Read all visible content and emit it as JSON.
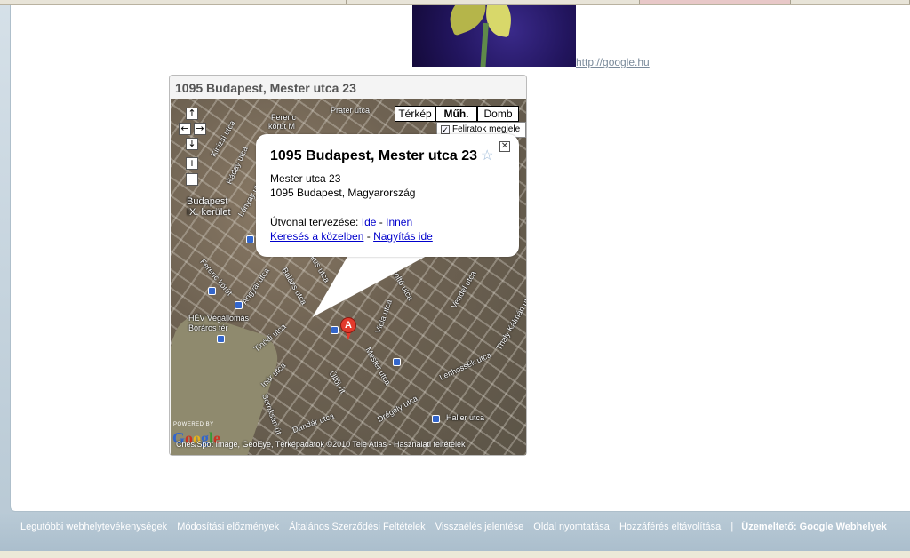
{
  "image_link": "http://google.hu",
  "map": {
    "title": "1095 Budapest, Mester utca 23",
    "map_types": [
      "Térkép",
      "Műh.",
      "Domb"
    ],
    "active_map_type": "Műh.",
    "labels_checkbox": "Feliratok megjele",
    "labels_checked": true,
    "nav": {
      "up": "↑",
      "left": "←",
      "right": "→",
      "down": "↓",
      "zoom_in": "+",
      "zoom_out": "−"
    },
    "bubble": {
      "title": "1095 Budapest, Mester utca 23",
      "star": "☆",
      "close": "✕",
      "address_line1": "Mester utca 23",
      "address_line2": "1095 Budapest, Magyarország",
      "route_label": "Útvonal tervezése:",
      "route_to": "Ide",
      "route_sep": "-",
      "route_from": "Innen",
      "search_nearby": "Keresés a közelben",
      "zoom_here": "Nagyítás ide"
    },
    "marker_letter": "A",
    "district_label_1": "Budapest",
    "district_label_2": "IX. kerület",
    "station_label_1": "HÉV Végállomás",
    "station_label_2": "Boráros tér",
    "streets": {
      "prater": "Prater utca",
      "ferenc": "Ferenc",
      "korut": "körút M",
      "kinizsi": "Kinizsi utca",
      "raday": "Ráday utca",
      "lonyay": "Lónyay utca",
      "angyal": "Angyal utca",
      "ferenckorut": "Ferenc körút",
      "balazs": "Balázs utca",
      "tinodi": "Tinódi utca",
      "mester": "Mester utca",
      "viola": "Viola utca",
      "vendel": "Vendel utca",
      "thaly": "Thaly Kálmán utca",
      "lenhossek": "Lenhossék utca",
      "inar": "Inár utca",
      "soroksari": "Soroksári út",
      "haller": "Haller utca",
      "dandar": "Dandár utca",
      "drégely": "Drégely utca",
      "markus": "Márkus utca",
      "ullöi": "Üllői út",
      "tüzolto": "Tűzoltó utca"
    },
    "powered_by": "POWERED BY",
    "google_logo": "Google",
    "copyright": "Cnes/Spot Image, GeoEye, Térképadatok ©2010 Tele Atlas - Használati feltételek"
  },
  "footer": {
    "links": [
      "Legutóbbi webhelytevékenységek",
      "Módosítási előzmények",
      "Általános Szerződési Feltételek",
      "Visszaélés jelentése",
      "Oldal nyomtatása",
      "Hozzáférés eltávolítása"
    ],
    "separator": "|",
    "owner": "Üzemeltető: Google Webhelyek"
  },
  "colors": {
    "link_blue": "#0000cc",
    "marker_red": "#e23a2c",
    "footer_bg": "#b9cad6"
  }
}
